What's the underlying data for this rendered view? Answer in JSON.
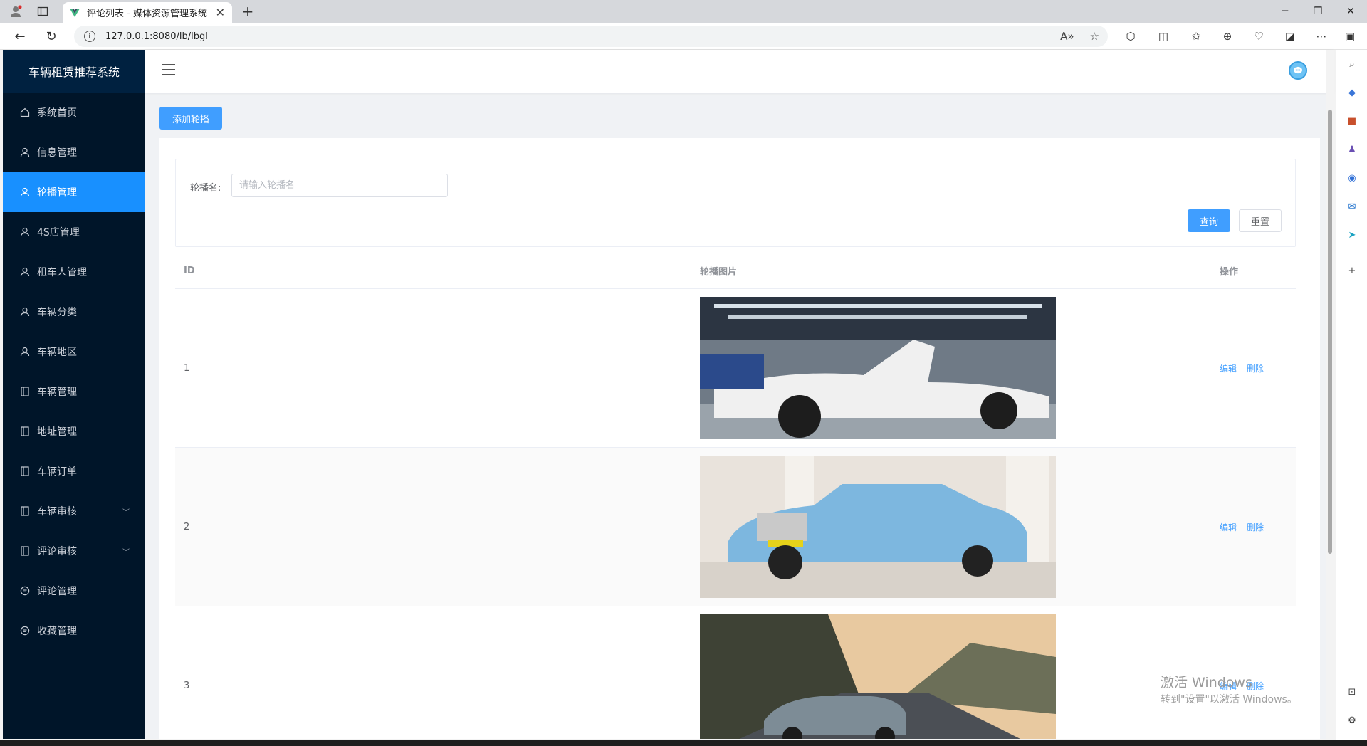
{
  "browser": {
    "tab_title": "评论列表 - 媒体资源管理系统",
    "url": "127.0.0.1:8080/lb/lbgl",
    "new_tab": "+"
  },
  "app": {
    "brand": "车辆租赁推荐系统",
    "menu": [
      {
        "label": "系统首页",
        "icon": "home-icon"
      },
      {
        "label": "信息管理",
        "icon": "user-icon"
      },
      {
        "label": "轮播管理",
        "icon": "user-icon",
        "active": true
      },
      {
        "label": "4S店管理",
        "icon": "user-icon"
      },
      {
        "label": "租车人管理",
        "icon": "user-icon"
      },
      {
        "label": "车辆分类",
        "icon": "user-icon"
      },
      {
        "label": "车辆地区",
        "icon": "user-icon"
      },
      {
        "label": "车辆管理",
        "icon": "document-icon"
      },
      {
        "label": "地址管理",
        "icon": "document-icon"
      },
      {
        "label": "车辆订单",
        "icon": "document-icon"
      },
      {
        "label": "车辆审核",
        "icon": "document-icon",
        "expandable": true
      },
      {
        "label": "评论审核",
        "icon": "document-icon",
        "expandable": true
      },
      {
        "label": "评论管理",
        "icon": "chat-icon"
      },
      {
        "label": "收藏管理",
        "icon": "chat-icon"
      }
    ]
  },
  "page": {
    "add_button": "添加轮播",
    "search_label": "轮播名:",
    "search_placeholder": "请输入轮播名",
    "query_button": "查询",
    "reset_button": "重置",
    "columns": {
      "id": "ID",
      "image": "轮播图片",
      "ops": "操作"
    },
    "rows": [
      {
        "id": "1",
        "edit": "编辑",
        "delete": "删除"
      },
      {
        "id": "2",
        "edit": "编辑",
        "delete": "删除"
      },
      {
        "id": "3",
        "edit": "编辑",
        "delete": "删除"
      }
    ]
  },
  "watermark": {
    "line1": "激活 Windows",
    "line2": "转到\"设置\"以激活 Windows。"
  },
  "colors": {
    "sidebar": "#001529",
    "accent": "#1890ff",
    "button": "#409eff"
  }
}
